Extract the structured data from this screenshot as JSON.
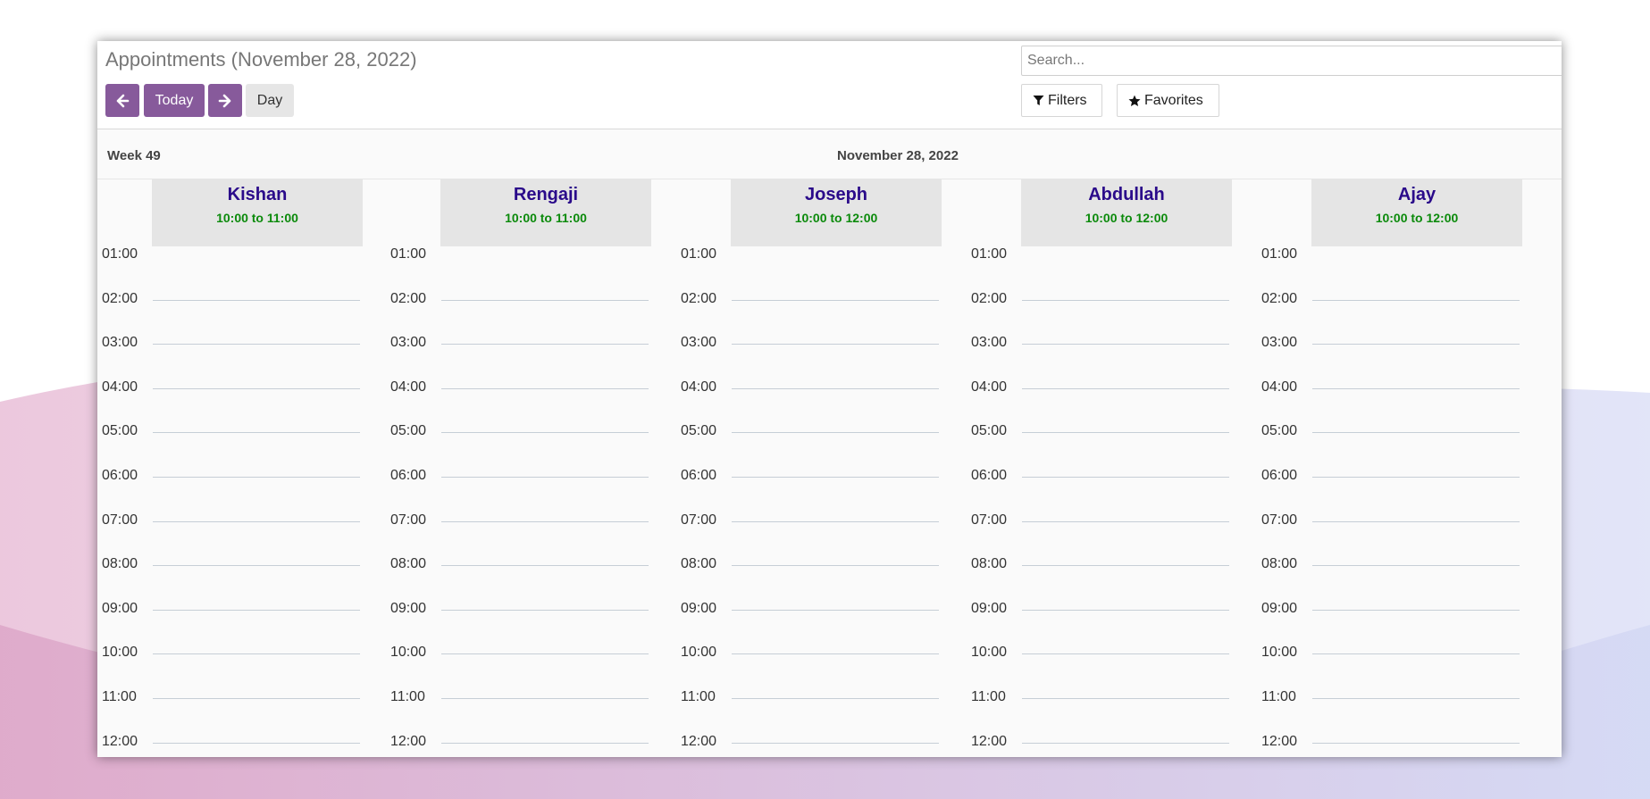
{
  "title": "Appointments (November 28, 2022)",
  "nav": {
    "today_label": "Today",
    "view_label": "Day"
  },
  "search": {
    "placeholder": "Search..."
  },
  "filters_label": "Filters",
  "favorites_label": "Favorites",
  "week_label": "Week 49",
  "date_heading": "November 28, 2022",
  "colors": {
    "accent": "#875a9b",
    "name": "#2a0a8a",
    "hours": "#0b8a0b"
  },
  "columns": [
    {
      "name": "Kishan",
      "hours": "10:00 to 11:00"
    },
    {
      "name": "Rengaji",
      "hours": "10:00 to 11:00"
    },
    {
      "name": "Joseph",
      "hours": "10:00 to 12:00"
    },
    {
      "name": "Abdullah",
      "hours": "10:00 to 12:00"
    },
    {
      "name": "Ajay",
      "hours": "10:00 to 12:00"
    }
  ],
  "time_slots": [
    "01:00",
    "02:00",
    "03:00",
    "04:00",
    "05:00",
    "06:00",
    "07:00",
    "08:00",
    "09:00",
    "10:00",
    "11:00",
    "12:00"
  ]
}
